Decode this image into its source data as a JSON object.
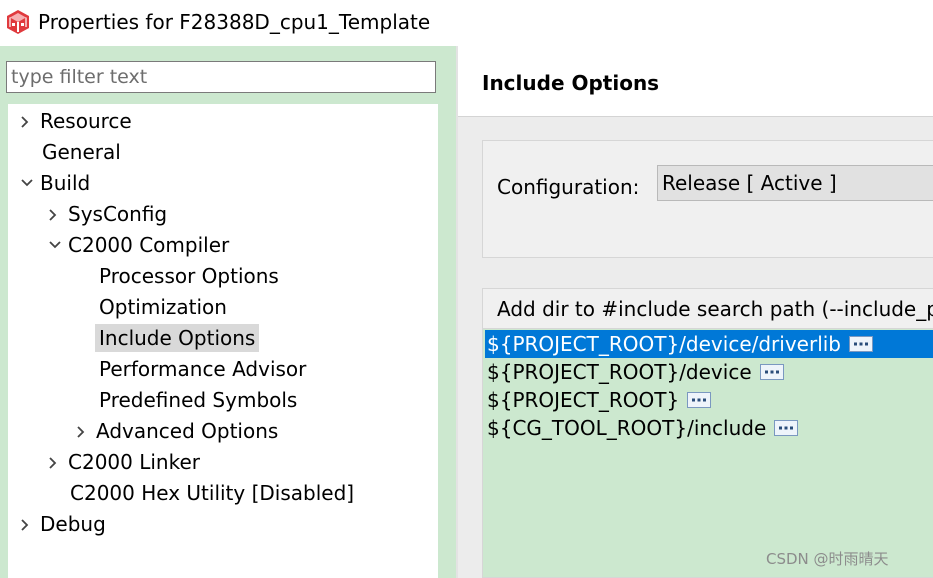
{
  "window": {
    "title": "Properties for F28388D_cpu1_Template",
    "icon": "eclipse-cube-icon",
    "icon_color": "#e03a3e"
  },
  "filter": {
    "placeholder": "type filter text",
    "value": ""
  },
  "tree": {
    "items": [
      {
        "label": "Resource",
        "expander": "collapsed"
      },
      {
        "label": "General",
        "expander": "none"
      },
      {
        "label": "Build",
        "expander": "expanded"
      },
      {
        "label": "SysConfig",
        "expander": "collapsed"
      },
      {
        "label": "C2000 Compiler",
        "expander": "expanded"
      },
      {
        "label": "Processor Options",
        "expander": "none"
      },
      {
        "label": "Optimization",
        "expander": "none"
      },
      {
        "label": "Include Options",
        "expander": "none",
        "selected": true
      },
      {
        "label": "Performance Advisor",
        "expander": "none"
      },
      {
        "label": "Predefined Symbols",
        "expander": "none"
      },
      {
        "label": "Advanced Options",
        "expander": "collapsed"
      },
      {
        "label": "C2000 Linker",
        "expander": "collapsed"
      },
      {
        "label": "C2000 Hex Utility  [Disabled]",
        "expander": "none"
      },
      {
        "label": "Debug",
        "expander": "collapsed"
      }
    ]
  },
  "page": {
    "title": "Include Options"
  },
  "configuration": {
    "label": "Configuration:",
    "value": "Release  [ Active ]"
  },
  "include_paths": {
    "header": "Add dir to #include search path (--include_path, -I)",
    "items": [
      {
        "path": "${PROJECT_ROOT}/device/driverlib",
        "selected": true
      },
      {
        "path": "${PROJECT_ROOT}/device",
        "selected": false
      },
      {
        "path": "${PROJECT_ROOT}",
        "selected": false
      },
      {
        "path": "${CG_TOOL_ROOT}/include",
        "selected": false
      }
    ]
  },
  "watermark": "CSDN @时雨晴天",
  "colors": {
    "panel_green": "#cce8cf",
    "selection_blue": "#0078d7",
    "tree_selection_gray": "#d9d9d9"
  }
}
